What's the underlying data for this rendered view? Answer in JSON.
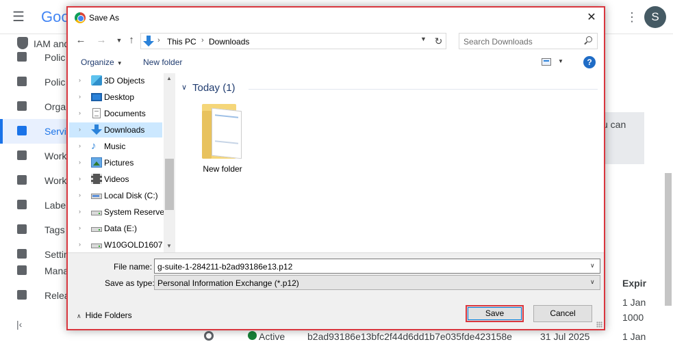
{
  "background": {
    "logo_text": "Goo",
    "avatar_letter": "S",
    "sidebar": {
      "header": "IAM and",
      "items": [
        {
          "label": "Polic"
        },
        {
          "label": "Polic"
        },
        {
          "label": "Orga"
        },
        {
          "label": "Servi",
          "active": true
        },
        {
          "label": "Work"
        },
        {
          "label": "Work"
        },
        {
          "label": "Labe"
        },
        {
          "label": "Tags"
        },
        {
          "label": "Settin"
        },
        {
          "label": "Mana"
        },
        {
          "label": "Relea"
        }
      ],
      "collapse_glyph": "|‹"
    },
    "hint_text": "u can",
    "table": {
      "column_header": "Expir",
      "cell_1": "1 Jan",
      "cell_2": "1000",
      "bottom_row": {
        "status": "Active",
        "key_id": "b2ad93186e13bfc2f44d6dd1b7e035fde423158e",
        "date": "31 Jul 2025",
        "expiry": "1 Jan"
      }
    }
  },
  "dialog": {
    "title": "Save As",
    "address": {
      "crumbs": [
        "This PC",
        "Downloads"
      ]
    },
    "search": {
      "placeholder": "Search Downloads"
    },
    "toolbar": {
      "organize_label": "Organize",
      "new_folder_label": "New folder",
      "help_label": "?"
    },
    "tree": [
      {
        "label": "3D Objects",
        "icon": "3d-objects-icon"
      },
      {
        "label": "Desktop",
        "icon": "desktop-icon"
      },
      {
        "label": "Documents",
        "icon": "documents-icon"
      },
      {
        "label": "Downloads",
        "icon": "downloads-icon",
        "selected": true
      },
      {
        "label": "Music",
        "icon": "music-icon"
      },
      {
        "label": "Pictures",
        "icon": "pictures-icon"
      },
      {
        "label": "Videos",
        "icon": "videos-icon"
      },
      {
        "label": "Local Disk (C:)",
        "icon": "local-disk-icon"
      },
      {
        "label": "System Reserved",
        "icon": "drive-icon"
      },
      {
        "label": "Data (E:)",
        "icon": "drive-icon"
      },
      {
        "label": "W10GOLD1607 (",
        "icon": "drive-icon"
      }
    ],
    "content": {
      "group_label": "Today (1)",
      "items": [
        {
          "label": "New folder"
        }
      ]
    },
    "form": {
      "file_name_label": "File name:",
      "file_name_value": "g-suite-1-284211-b2ad93186e13.p12",
      "save_type_label": "Save as type:",
      "save_type_value": "Personal Information Exchange (*.p12)",
      "hide_folders_label": "Hide Folders",
      "save_label": "Save",
      "cancel_label": "Cancel"
    }
  },
  "colors": {
    "dialog_border": "#d9363e",
    "accent": "#1a73e8",
    "selection": "#cce8ff",
    "heading": "#1e3a6e"
  }
}
